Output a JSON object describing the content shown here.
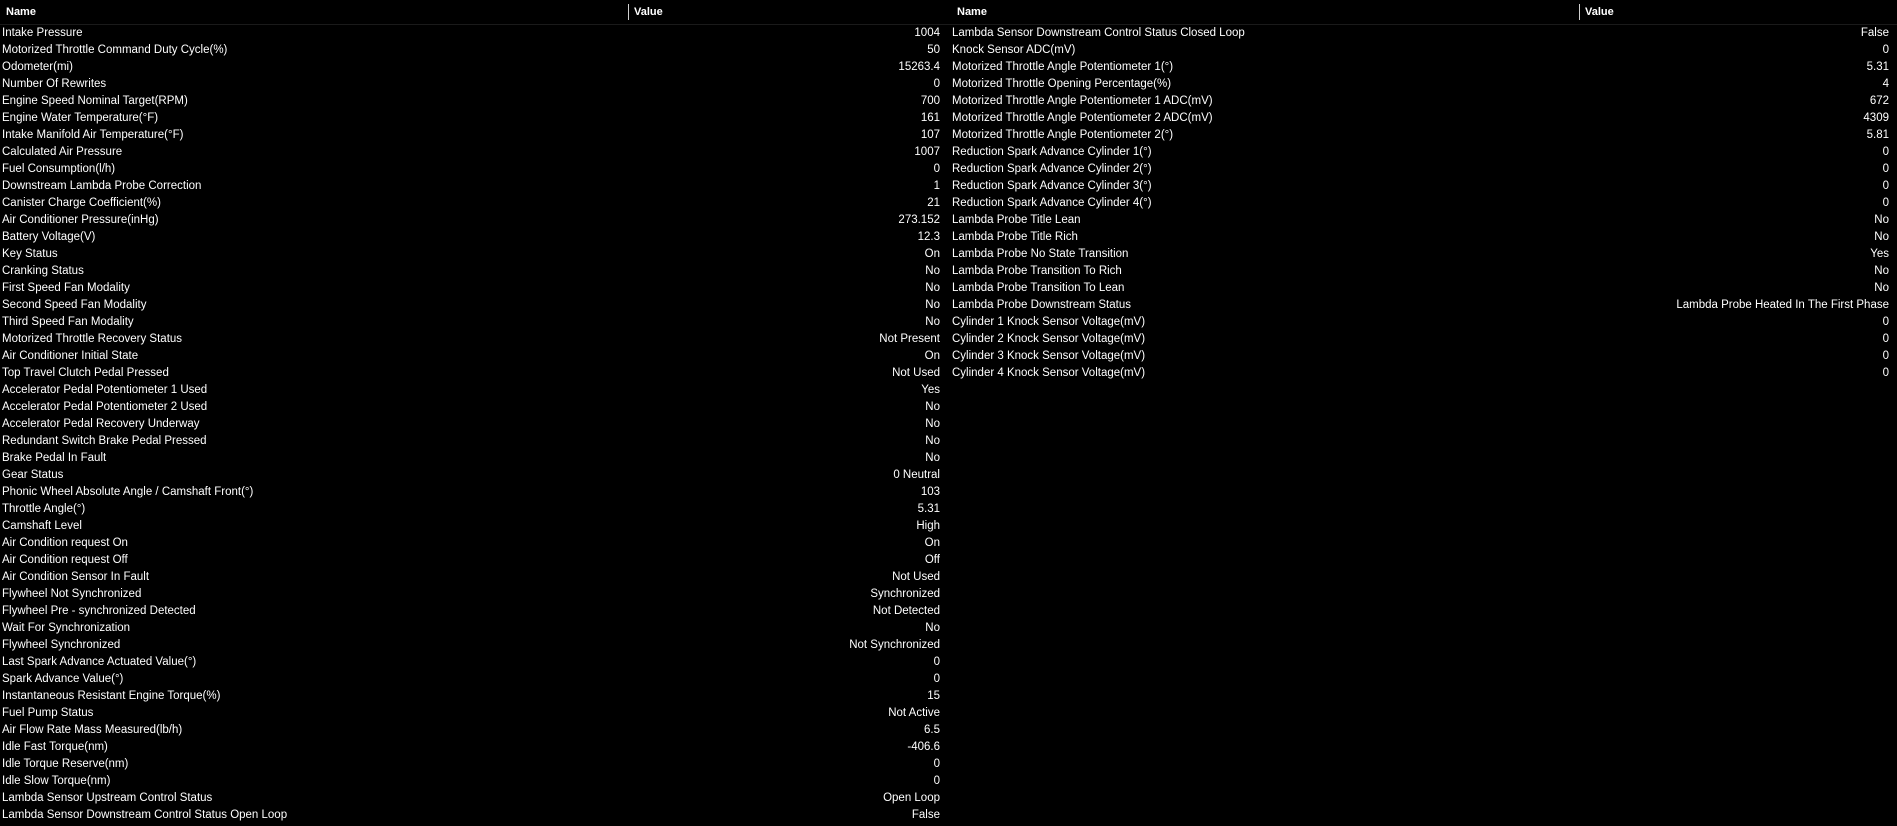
{
  "headers": {
    "name": "Name",
    "value": "Value"
  },
  "left": [
    {
      "name": "Intake Pressure",
      "value": "1004"
    },
    {
      "name": "Motorized Throttle Command Duty Cycle(%)",
      "value": "50"
    },
    {
      "name": "Odometer(mi)",
      "value": "15263.4"
    },
    {
      "name": "Number Of Rewrites",
      "value": "0"
    },
    {
      "name": "Engine Speed Nominal Target(RPM)",
      "value": "700"
    },
    {
      "name": "Engine Water Temperature(°F)",
      "value": "161"
    },
    {
      "name": "Intake Manifold Air Temperature(°F)",
      "value": "107"
    },
    {
      "name": "Calculated Air Pressure",
      "value": "1007"
    },
    {
      "name": "Fuel Consumption(l/h)",
      "value": "0"
    },
    {
      "name": "Downstream Lambda Probe Correction",
      "value": "1"
    },
    {
      "name": "Canister Charge Coefficient(%)",
      "value": "21"
    },
    {
      "name": "Air Conditioner Pressure(inHg)",
      "value": "273.152"
    },
    {
      "name": "Battery Voltage(V)",
      "value": "12.3"
    },
    {
      "name": "Key Status",
      "value": "On"
    },
    {
      "name": "Cranking Status",
      "value": "No"
    },
    {
      "name": "First Speed Fan Modality",
      "value": "No"
    },
    {
      "name": "Second Speed Fan Modality",
      "value": "No"
    },
    {
      "name": "Third Speed Fan Modality",
      "value": "No"
    },
    {
      "name": "Motorized Throttle Recovery Status",
      "value": "Not Present"
    },
    {
      "name": "Air Conditioner Initial State",
      "value": "On"
    },
    {
      "name": "Top Travel Clutch Pedal Pressed",
      "value": "Not Used"
    },
    {
      "name": "Accelerator Pedal Potentiometer 1 Used",
      "value": "Yes"
    },
    {
      "name": "Accelerator Pedal Potentiometer 2 Used",
      "value": "No"
    },
    {
      "name": "Accelerator Pedal Recovery Underway",
      "value": "No"
    },
    {
      "name": "Redundant Switch Brake Pedal Pressed",
      "value": "No"
    },
    {
      "name": "Brake Pedal In Fault",
      "value": "No"
    },
    {
      "name": "Gear Status",
      "value": "0 Neutral"
    },
    {
      "name": "Phonic Wheel Absolute Angle / Camshaft Front(°)",
      "value": "103"
    },
    {
      "name": "Throttle Angle(°)",
      "value": "5.31"
    },
    {
      "name": "Camshaft Level",
      "value": "High"
    },
    {
      "name": "Air Condition request On",
      "value": "On"
    },
    {
      "name": "Air Condition request Off",
      "value": "Off"
    },
    {
      "name": "Air Condition Sensor In Fault",
      "value": "Not Used"
    },
    {
      "name": "Flywheel Not Synchronized",
      "value": "Synchronized"
    },
    {
      "name": "Flywheel Pre - synchronized Detected",
      "value": "Not Detected"
    },
    {
      "name": "Wait For Synchronization",
      "value": "No"
    },
    {
      "name": "Flywheel Synchronized",
      "value": "Not Synchronized"
    },
    {
      "name": "Last Spark Advance Actuated Value(°)",
      "value": "0"
    },
    {
      "name": "Spark Advance Value(°)",
      "value": "0"
    },
    {
      "name": "Instantaneous Resistant Engine Torque(%)",
      "value": "15"
    },
    {
      "name": "Fuel Pump Status",
      "value": "Not Active"
    },
    {
      "name": "Air Flow Rate Mass Measured(lb/h)",
      "value": "6.5"
    },
    {
      "name": "Idle Fast Torque(nm)",
      "value": "-406.6"
    },
    {
      "name": "Idle Torque Reserve(nm)",
      "value": "0"
    },
    {
      "name": "Idle Slow Torque(nm)",
      "value": "0"
    },
    {
      "name": "Lambda Sensor Upstream Control Status",
      "value": "Open Loop"
    },
    {
      "name": "Lambda Sensor Downstream Control Status Open Loop",
      "value": "False"
    }
  ],
  "right": [
    {
      "name": "Lambda Sensor Downstream Control Status Closed Loop",
      "value": "False"
    },
    {
      "name": "Knock Sensor ADC(mV)",
      "value": "0"
    },
    {
      "name": "Motorized Throttle Angle Potentiometer 1(°)",
      "value": "5.31"
    },
    {
      "name": "Motorized Throttle Opening Percentage(%)",
      "value": "4"
    },
    {
      "name": "Motorized Throttle Angle Potentiometer 1 ADC(mV)",
      "value": "672"
    },
    {
      "name": "Motorized Throttle Angle Potentiometer 2 ADC(mV)",
      "value": "4309"
    },
    {
      "name": "Motorized Throttle Angle Potentiometer 2(°)",
      "value": "5.81"
    },
    {
      "name": "Reduction Spark Advance Cylinder 1(°)",
      "value": "0"
    },
    {
      "name": "Reduction Spark Advance Cylinder 2(°)",
      "value": "0"
    },
    {
      "name": "Reduction Spark Advance Cylinder 3(°)",
      "value": "0"
    },
    {
      "name": "Reduction Spark Advance Cylinder 4(°)",
      "value": "0"
    },
    {
      "name": "Lambda Probe Title Lean",
      "value": "No"
    },
    {
      "name": "Lambda Probe Title Rich",
      "value": "No"
    },
    {
      "name": "Lambda Probe No State Transition",
      "value": "Yes"
    },
    {
      "name": "Lambda Probe Transition To Rich",
      "value": "No"
    },
    {
      "name": "Lambda Probe Transition To Lean",
      "value": "No"
    },
    {
      "name": "Lambda Probe Downstream Status",
      "value": "Lambda Probe Heated In The First Phase"
    },
    {
      "name": "Cylinder 1 Knock Sensor Voltage(mV)",
      "value": "0"
    },
    {
      "name": "Cylinder 2 Knock Sensor Voltage(mV)",
      "value": "0"
    },
    {
      "name": "Cylinder 3 Knock Sensor Voltage(mV)",
      "value": "0"
    },
    {
      "name": "Cylinder 4 Knock Sensor Voltage(mV)",
      "value": "0"
    }
  ]
}
